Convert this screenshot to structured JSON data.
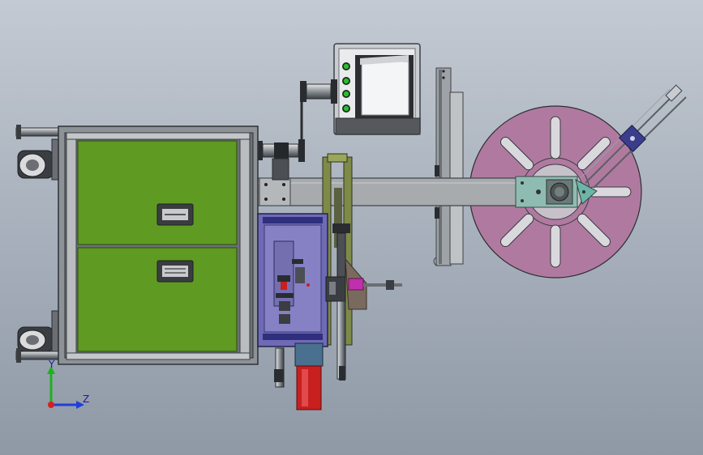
{
  "axes": {
    "y_label": "Y",
    "z_label": "Z",
    "y_color": "#1fb01f",
    "z_color": "#1f3fd8",
    "origin_color": "#d81f1f"
  },
  "colors": {
    "cabinet_green": "#5f9a22",
    "frame_gray": "#8d9296",
    "dark_steel": "#3b3f44",
    "reel_purple": "#b07aa0",
    "beam_gray": "#a7abad",
    "plate_blue": "#6e6ab6",
    "cylinder_red": "#c81f1f",
    "hmi_frame": "#c9cdd1",
    "led_green": "#29c02d",
    "bracket_teal": "#6cb5a8",
    "block_navy": "#2f2f7e",
    "magenta_part": "#c12fae"
  }
}
